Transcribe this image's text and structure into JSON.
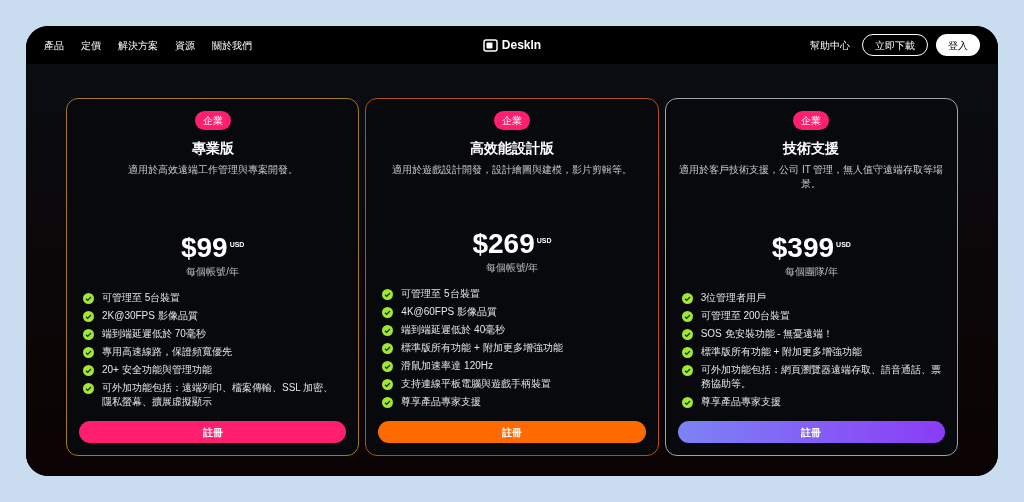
{
  "nav": {
    "links": [
      "產品",
      "定價",
      "解決方案",
      "資源",
      "關於我們"
    ],
    "logo": "DeskIn",
    "help": "幫助中心",
    "download": "立即下載",
    "login": "登入"
  },
  "plans": [
    {
      "badge": "企業",
      "name": "專業版",
      "description": "適用於高效遠端工作管理與專案開發。",
      "price": "$99",
      "currency": "USD",
      "period": "每個帳號/年",
      "color": "#ff1f6e",
      "kind": "gold",
      "features": [
        "可管理至 5台裝置",
        "2K@30FPS 影像品質",
        "端到端延遲低於 70毫秒",
        "專用高速線路，保證頻寬優先",
        "20+ 安全功能與管理功能",
        "可外加功能包括：遠端列印、檔案傳輸、SSL 加密、隱私螢幕、擴展虛擬顯示"
      ],
      "button": "註冊"
    },
    {
      "badge": "企業",
      "name": "高效能設計版",
      "description": "適用於遊戲設計開發，設計繪圖與建模，影片剪輯等。",
      "price": "$269",
      "currency": "USD",
      "period": "每個帳號/年",
      "color": "#ff6a00",
      "kind": "ember",
      "features": [
        "可管理至 5台裝置",
        "4K@60FPS 影像品質",
        "端到端延遲低於 40毫秒",
        "標準版所有功能 + 附加更多增強功能",
        "滑鼠加速率達 120Hz",
        "支持連線平板電腦與遊戲手柄裝置",
        "尊享產品專家支援"
      ],
      "button": "註冊"
    },
    {
      "badge": "企業",
      "name": "技術支援",
      "description": "適用於客戶技術支援，公司 IT 管理，無人值守遠端存取等場景。",
      "price": "$399",
      "currency": "USD",
      "period": "每個團隊/年",
      "color": "#8b3cf6",
      "kind": "silver",
      "features": [
        "3位管理者用戶",
        "可管理至 200台裝置",
        "SOS 免安裝功能 - 無憂遠端！",
        "標準版所有功能 + 附加更多增強功能",
        "可外加功能包括：網頁瀏覽器遠端存取、語音通話、票務協助等。",
        "尊享產品專家支援"
      ],
      "button": "註冊"
    }
  ]
}
